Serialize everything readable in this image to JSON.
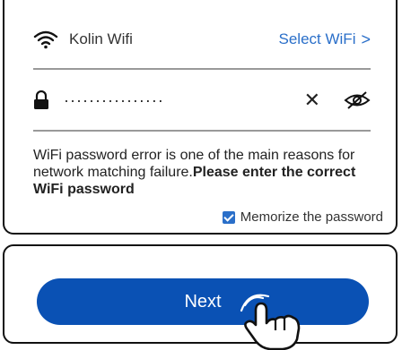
{
  "wifi": {
    "ssid": "Kolin Wifi",
    "select_label": "Select WiFi",
    "chevron": ">"
  },
  "password": {
    "masked_value": "················",
    "clear_icon": "close-icon",
    "visibility_icon": "eye-off-icon"
  },
  "hint": {
    "text": "WiFi password error is one of the main reasons for network matching failure.",
    "emphasis": "Please enter the correct WiFi password"
  },
  "memorize": {
    "label": "Memorize the password",
    "checked": true
  },
  "next_button": {
    "label": "Next"
  },
  "colors": {
    "accent": "#2a6fc9",
    "button": "#0a51b4"
  }
}
